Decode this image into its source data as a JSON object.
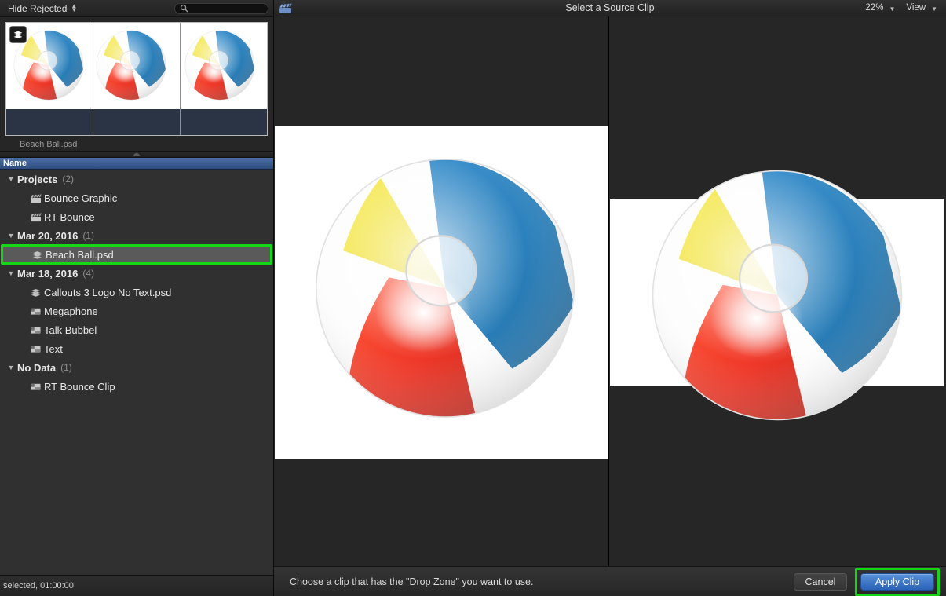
{
  "browser": {
    "toolbar": {
      "filter_label": "Hide Rejected",
      "stepper_icon": "up-down-stepper-icon",
      "search_icon": "search-icon",
      "search_placeholder": "",
      "search_value": ""
    },
    "filmstrip": {
      "badge_icon": "layered-psd-icon",
      "clip_name": "Beach Ball.psd",
      "frame_count": 3
    },
    "list_header": {
      "column_name": "Name"
    },
    "items": [
      {
        "label": "Projects",
        "count": "(2)",
        "type": "group",
        "level": 0,
        "icon": "disclosure-triangle-icon",
        "expanded": true
      },
      {
        "label": "Bounce Graphic",
        "count": "",
        "type": "clip",
        "level": 1,
        "icon": "clapperboard-icon"
      },
      {
        "label": "RT Bounce",
        "count": "",
        "type": "clip",
        "level": 1,
        "icon": "clapperboard-icon"
      },
      {
        "label": "Mar 20, 2016",
        "count": "(1)",
        "type": "group",
        "level": 0,
        "icon": "disclosure-triangle-icon",
        "expanded": true
      },
      {
        "label": "Beach Ball.psd",
        "count": "",
        "type": "psd",
        "level": 1,
        "icon": "layered-psd-icon",
        "selected": true
      },
      {
        "label": "Mar 18, 2016",
        "count": "(4)",
        "type": "group",
        "level": 0,
        "icon": "disclosure-triangle-icon",
        "expanded": true
      },
      {
        "label": "Callouts 3 Logo No Text.psd",
        "count": "",
        "type": "psd",
        "level": 1,
        "icon": "layered-psd-icon"
      },
      {
        "label": "Megaphone",
        "count": "",
        "type": "title",
        "level": 1,
        "icon": "title-clip-icon"
      },
      {
        "label": "Talk Bubbel",
        "count": "",
        "type": "title",
        "level": 1,
        "icon": "title-clip-icon"
      },
      {
        "label": "Text",
        "count": "",
        "type": "title",
        "level": 1,
        "icon": "title-clip-icon"
      },
      {
        "label": "No Data",
        "count": "(1)",
        "type": "group",
        "level": 0,
        "icon": "disclosure-triangle-icon",
        "expanded": true
      },
      {
        "label": "RT Bounce Clip",
        "count": "",
        "type": "title",
        "level": 1,
        "icon": "title-clip-icon"
      }
    ],
    "status": {
      "text": "selected, 01:00:00"
    }
  },
  "viewer": {
    "toolbar": {
      "clip_icon": "clapperboard-icon",
      "title": "Select a Source Clip",
      "zoom_level": "22%",
      "view_label": "View",
      "chevron_icon": "chevron-down-icon"
    },
    "content": {
      "left_image": "beach-ball-image",
      "right_image": "beach-ball-image"
    }
  },
  "bottom_bar": {
    "message": "Choose a clip that has the \"Drop Zone\" you want to use.",
    "cancel_label": "Cancel",
    "apply_label": "Apply Clip"
  },
  "colors": {
    "selection_highlight": "#16d716",
    "accent_blue": "#2a62b8",
    "header_blue": "#3c5f92",
    "ball_red": "#ee2211",
    "ball_blue": "#1272b4",
    "ball_yellow": "#eedd22"
  }
}
